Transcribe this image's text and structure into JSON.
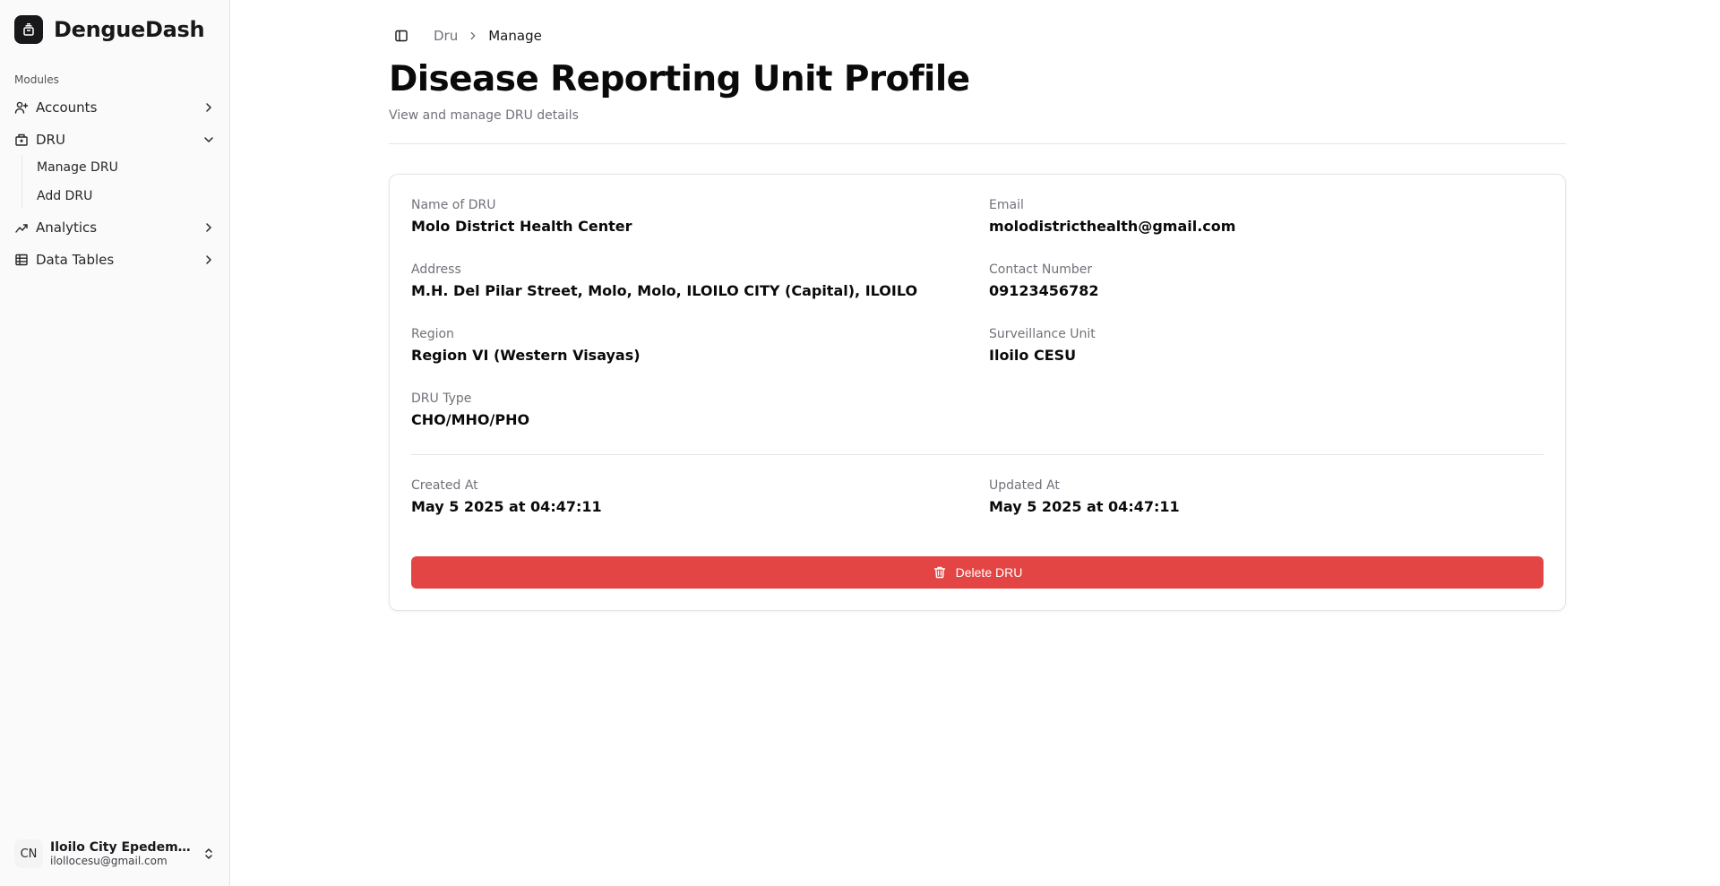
{
  "app": {
    "name": "DengueDash"
  },
  "sidebar": {
    "group_label": "Modules",
    "items": [
      {
        "label": "Accounts",
        "icon": "user-plus-icon",
        "chevron": "chevron-right-icon"
      },
      {
        "label": "DRU",
        "icon": "hospital-icon",
        "chevron": "chevron-down-icon",
        "children": [
          {
            "label": "Manage DRU"
          },
          {
            "label": "Add DRU"
          }
        ]
      },
      {
        "label": "Analytics",
        "icon": "chart-icon",
        "chevron": "chevron-right-icon"
      },
      {
        "label": "Data Tables",
        "icon": "table-icon",
        "chevron": "chevron-right-icon"
      }
    ],
    "user": {
      "initials": "CN",
      "name": "Iloilo City Epedemiol...",
      "email": "ilollocesu@gmail.com"
    }
  },
  "header": {
    "breadcrumb": [
      {
        "label": "Dru"
      },
      {
        "label": "Manage"
      }
    ]
  },
  "page": {
    "title": "Disease Reporting Unit Profile",
    "subtitle": "View and manage DRU details"
  },
  "profile": {
    "name_label": "Name of DRU",
    "name_value": "Molo District Health Center",
    "email_label": "Email",
    "email_value": "molodistricthealth@gmail.com",
    "address_label": "Address",
    "address_value": "M.H. Del Pilar Street, Molo, Molo, ILOILO CITY (Capital), ILOILO",
    "contact_label": "Contact Number",
    "contact_value": "09123456782",
    "region_label": "Region",
    "region_value": "Region VI (Western Visayas)",
    "surveillance_label": "Surveillance Unit",
    "surveillance_value": "Iloilo CESU",
    "type_label": "DRU Type",
    "type_value": "CHO/MHO/PHO",
    "created_label": "Created At",
    "created_value": "May 5 2025 at 04:47:11",
    "updated_label": "Updated At",
    "updated_value": "May 5 2025 at 04:47:11"
  },
  "actions": {
    "delete_label": "Delete DRU"
  },
  "colors": {
    "danger": "#e34545",
    "brand": "#18181b"
  }
}
